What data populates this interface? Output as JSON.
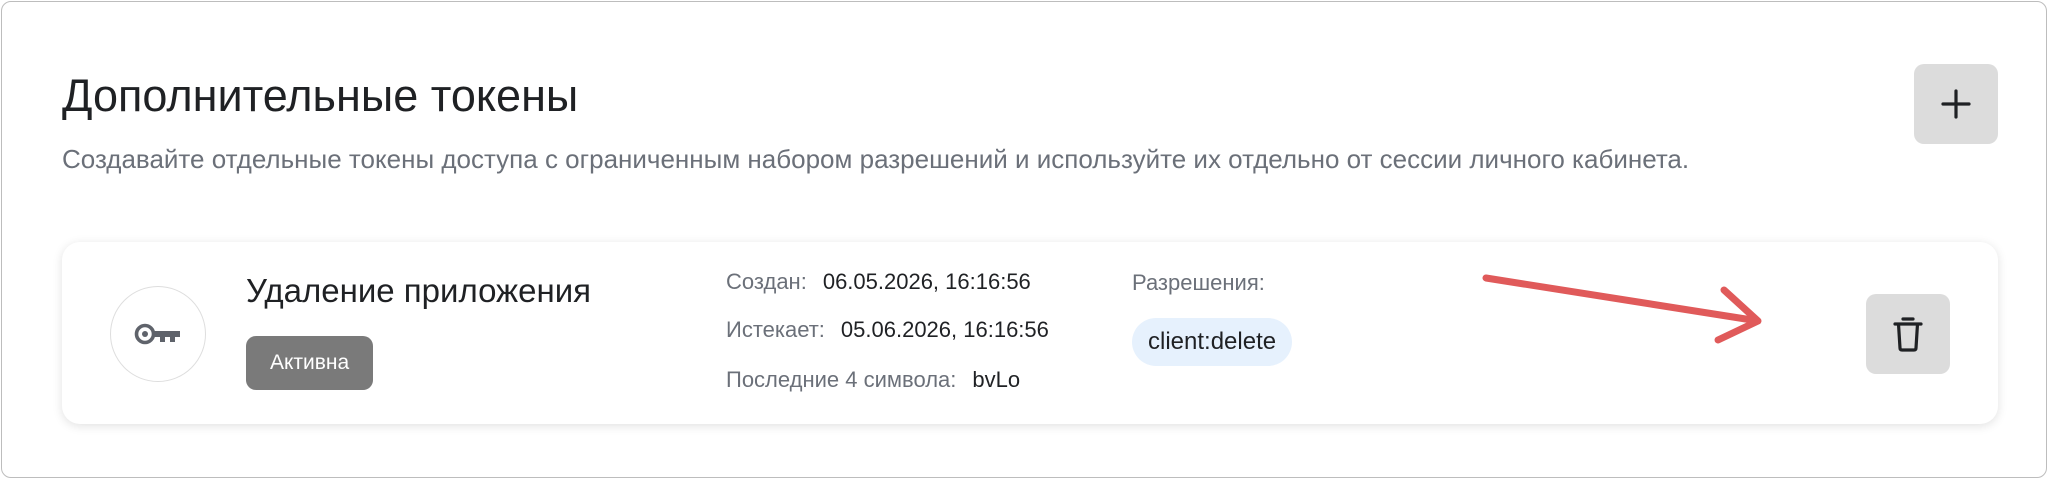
{
  "section": {
    "title": "Дополнительные токены",
    "subtitle": "Создавайте отдельные токены доступа с ограниченным набором разрешений и используйте их отдельно от сессии личного кабинета."
  },
  "add_button": {
    "icon": "plus-icon"
  },
  "token": {
    "icon": "key-icon",
    "name": "Удаление приложения",
    "status": "Активна",
    "created_label": "Создан:",
    "created_value": "06.05.2026, 16:16:56",
    "expires_label": "Истекает:",
    "expires_value": "05.06.2026, 16:16:56",
    "last4_label": "Последние 4 символа:",
    "last4_value": "bvLo",
    "permissions_label": "Разрешения:",
    "permissions": [
      "client:delete"
    ],
    "delete_icon": "trash-icon"
  },
  "colors": {
    "annotation_arrow": "#e05a5a",
    "status_badge": "#7a7a7a",
    "permission_chip": "#e6f1fd",
    "button_bg": "#dcdcdc"
  }
}
